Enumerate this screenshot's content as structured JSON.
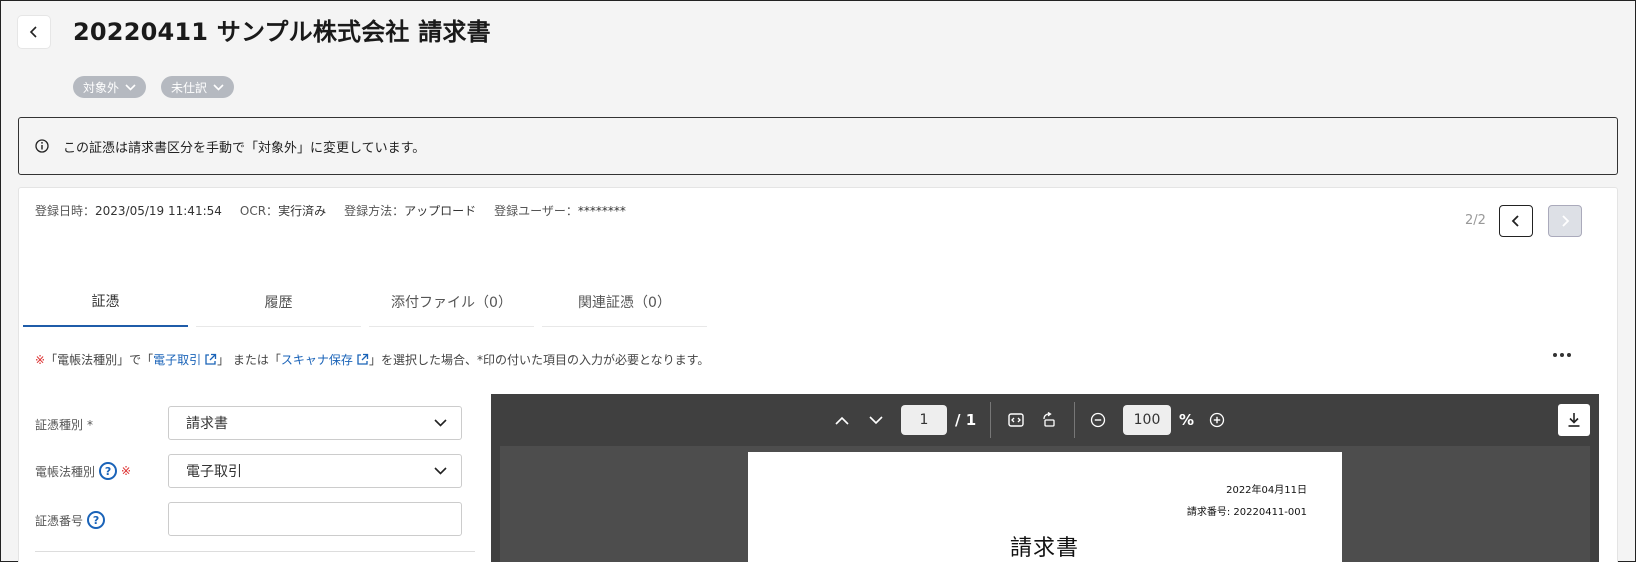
{
  "header": {
    "title": "20220411 サンプル株式会社 請求書",
    "tags": [
      {
        "label": "対象外"
      },
      {
        "label": "未仕訳"
      }
    ]
  },
  "notice": {
    "text": "この証憑は請求書区分を手動で「対象外」に変更しています。"
  },
  "meta": {
    "registered_label": "登録日時：",
    "registered_value": "2023/05/19 11:41:54",
    "ocr_label": "OCR：",
    "ocr_value": "実行済み",
    "method_label": "登録方法：",
    "method_value": "アップロード",
    "user_label": "登録ユーザー：",
    "user_value": "********"
  },
  "pager": {
    "text": "2/2"
  },
  "tabs": [
    {
      "label": "証憑",
      "active": true
    },
    {
      "label": "履歴",
      "active": false
    },
    {
      "label": "添付ファイル（0）",
      "active": false
    },
    {
      "label": "関連証憑（0）",
      "active": false
    }
  ],
  "hint": {
    "mark": "※",
    "part1": "「電帳法種別」で「",
    "link1": "電子取引",
    "part2": "」 または「",
    "link2": "スキャナ保存",
    "part3": "」を選択した場合、*印の付いた項目の入力が必要となります。"
  },
  "form": {
    "type_label": "証憑種別",
    "type_required": "*",
    "type_value": "請求書",
    "law_label": "電帳法種別",
    "law_mark": "※",
    "law_value": "電子取引",
    "number_label": "証憑番号",
    "number_value": ""
  },
  "viewer": {
    "page_current": "1",
    "page_total": "/ 1",
    "zoom_value": "100",
    "zoom_unit": "%"
  },
  "document": {
    "date": "2022年04月11日",
    "number": "請求番号: 20220411-001",
    "title": "請求書"
  },
  "colors": {
    "accent": "#1f5ca9",
    "link": "#1a63b8",
    "tag_bg": "#b5b9c0",
    "viewer_bg": "#404040",
    "required": "#dd3333"
  }
}
